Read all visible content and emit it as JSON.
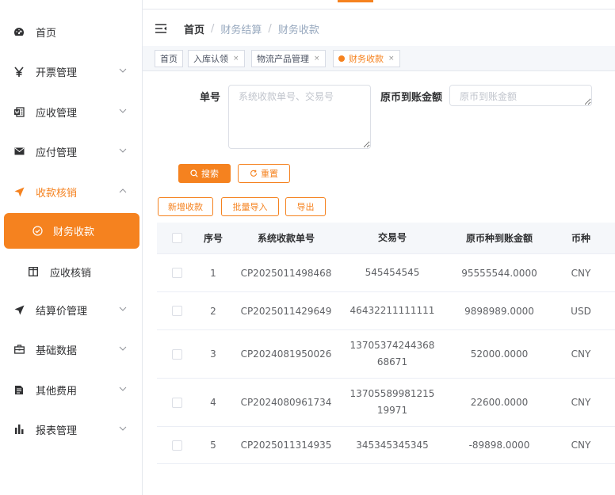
{
  "sidebar": {
    "items": [
      {
        "label": "首页",
        "icon": "dashboard-icon"
      },
      {
        "label": "开票管理",
        "icon": "yen-icon"
      },
      {
        "label": "应收管理",
        "icon": "word-doc-icon"
      },
      {
        "label": "应付管理",
        "icon": "envelope-icon"
      },
      {
        "label": "收款核销",
        "icon": "send-icon"
      },
      {
        "label": "结算价管理",
        "icon": "send-icon"
      },
      {
        "label": "基础数据",
        "icon": "briefcase-icon"
      },
      {
        "label": "其他费用",
        "icon": "document-icon"
      },
      {
        "label": "报表管理",
        "icon": "bar-chart-icon"
      }
    ],
    "active_sub": {
      "label": "财务收款",
      "icon": "check-circle-icon"
    },
    "sub_item": {
      "label": "应收核销",
      "icon": "columns-icon"
    }
  },
  "breadcrumb": {
    "home": "首页",
    "items": [
      "财务结算",
      "财务收款"
    ]
  },
  "tags": [
    {
      "label": "首页"
    },
    {
      "label": "入库认领"
    },
    {
      "label": "物流产品管理"
    },
    {
      "label": "财务收款"
    }
  ],
  "form": {
    "order_label": "单号",
    "order_placeholder": "系统收款单号、交易号",
    "amount_label": "原币到账金额",
    "amount_placeholder": "原币到账金额",
    "search_button": "搜索",
    "reset_button": "重置"
  },
  "toolbar": {
    "add_button": "新增收款",
    "import_button": "批量导入",
    "export_button": "导出"
  },
  "table": {
    "headers": [
      "序号",
      "系统收款单号",
      "交易号",
      "原币种到账金额",
      "币种"
    ],
    "rows": [
      {
        "idx": "1",
        "sys": "CP2025011498468",
        "trade": "545454545",
        "amount": "95555544.0000",
        "currency": "CNY"
      },
      {
        "idx": "2",
        "sys": "CP2025011429649",
        "trade": "46432211111111",
        "amount": "9898989.0000",
        "currency": "USD"
      },
      {
        "idx": "3",
        "sys": "CP2024081950026",
        "trade": "1370537424436868671",
        "amount": "52000.0000",
        "currency": "CNY"
      },
      {
        "idx": "4",
        "sys": "CP2024080961734",
        "trade": "1370558998121519971",
        "amount": "22600.0000",
        "currency": "CNY"
      },
      {
        "idx": "5",
        "sys": "CP2025011314935",
        "trade": "345345345345",
        "amount": "-89898.0000",
        "currency": "CNY"
      }
    ]
  },
  "colors": {
    "accent": "#f5821f"
  }
}
